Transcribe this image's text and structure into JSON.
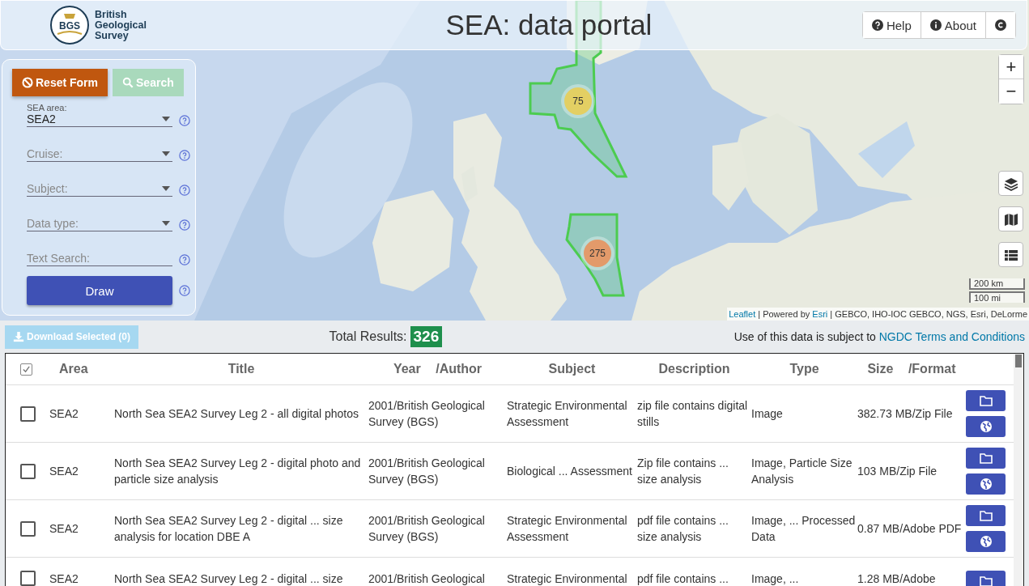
{
  "header": {
    "logo": {
      "mark": "BGS",
      "lines": [
        "British",
        "Geological",
        "Survey"
      ]
    },
    "title": "SEA: data portal",
    "buttons": [
      {
        "label": "Help",
        "kind": "help"
      },
      {
        "label": "About",
        "kind": "about"
      },
      {
        "kind": "copyright"
      }
    ]
  },
  "form": {
    "reset_button": "Reset Form",
    "search_button": {
      "label": "Search",
      "disabled": true
    },
    "fields": [
      {
        "label": "SEA area:",
        "value": "SEA2",
        "kind": "select"
      },
      {
        "label": "Cruise:",
        "kind": "select"
      },
      {
        "label": "Subject:",
        "kind": "select"
      },
      {
        "label": "Data type:",
        "kind": "select"
      },
      {
        "label": "Text Search:",
        "kind": "text"
      }
    ],
    "draw_button": "Draw"
  },
  "map": {
    "clusters": [
      {
        "count": "75",
        "color": "#e3cf63"
      },
      {
        "count": "275",
        "color": "#e39a6a"
      }
    ],
    "zoom": [
      "+",
      "−"
    ],
    "scale": [
      "200 km",
      "100 mi"
    ],
    "attribution": [
      {
        "kind": "link",
        "text": "Leaflet"
      },
      {
        "kind": "text",
        "text": " | Powered by "
      },
      {
        "kind": "link",
        "text": "Esri"
      },
      {
        "kind": "text",
        "text": " | GEBCO, IHO-IOC GEBCO, NGS, Esri, DeLorme"
      }
    ]
  },
  "toolbar": {
    "download_button": {
      "label": "Download Selected (0)",
      "disabled": true
    },
    "total_label": "Total Results:",
    "total": "326",
    "terms": [
      {
        "kind": "text",
        "text": "Use of this data is subject to "
      },
      {
        "kind": "link",
        "text": "NGDC Terms and Conditions"
      }
    ]
  },
  "table": {
    "select_all": {
      "checked": true
    },
    "columns": [
      "Area",
      "Title",
      "Year /Author",
      "Subject",
      "Description",
      "Type",
      "Size /Format"
    ],
    "rows": [
      {
        "checked": false,
        "cells": [
          "SEA2",
          "North Sea SEA2 Survey Leg 2 - all digital photos",
          "2001/British Geological Survey (BGS)",
          "Strategic Environmental Assessment",
          "zip file contains digital stills",
          "Image",
          "382.73 MB/Zip File"
        ]
      },
      {
        "checked": false,
        "cells": [
          "SEA2",
          "North Sea SEA2 Survey Leg 2 - digital photo and particle size analysis",
          "2001/British Geological Survey (BGS)",
          "Biological ... Assessment",
          "Zip file contains ... size analysis",
          "Image, Particle Size Analysis",
          "103 MB/Zip File"
        ]
      },
      {
        "checked": false,
        "cells": [
          "SEA2",
          "North Sea SEA2 Survey Leg 2 - digital ... size analysis for location DBE A",
          "2001/British Geological Survey (BGS)",
          "Strategic Environmental Assessment",
          "pdf file contains ... size analysis",
          "Image, ... Processed Data",
          "0.87 MB/Adobe PDF"
        ]
      },
      {
        "checked": false,
        "cells": [
          "SEA2",
          "North Sea SEA2 Survey Leg 2 - digital ... size",
          "2001/British Geological",
          "Strategic Environmental",
          "pdf file contains ...",
          "Image, ...",
          "1.28 MB/Adobe"
        ]
      }
    ]
  }
}
